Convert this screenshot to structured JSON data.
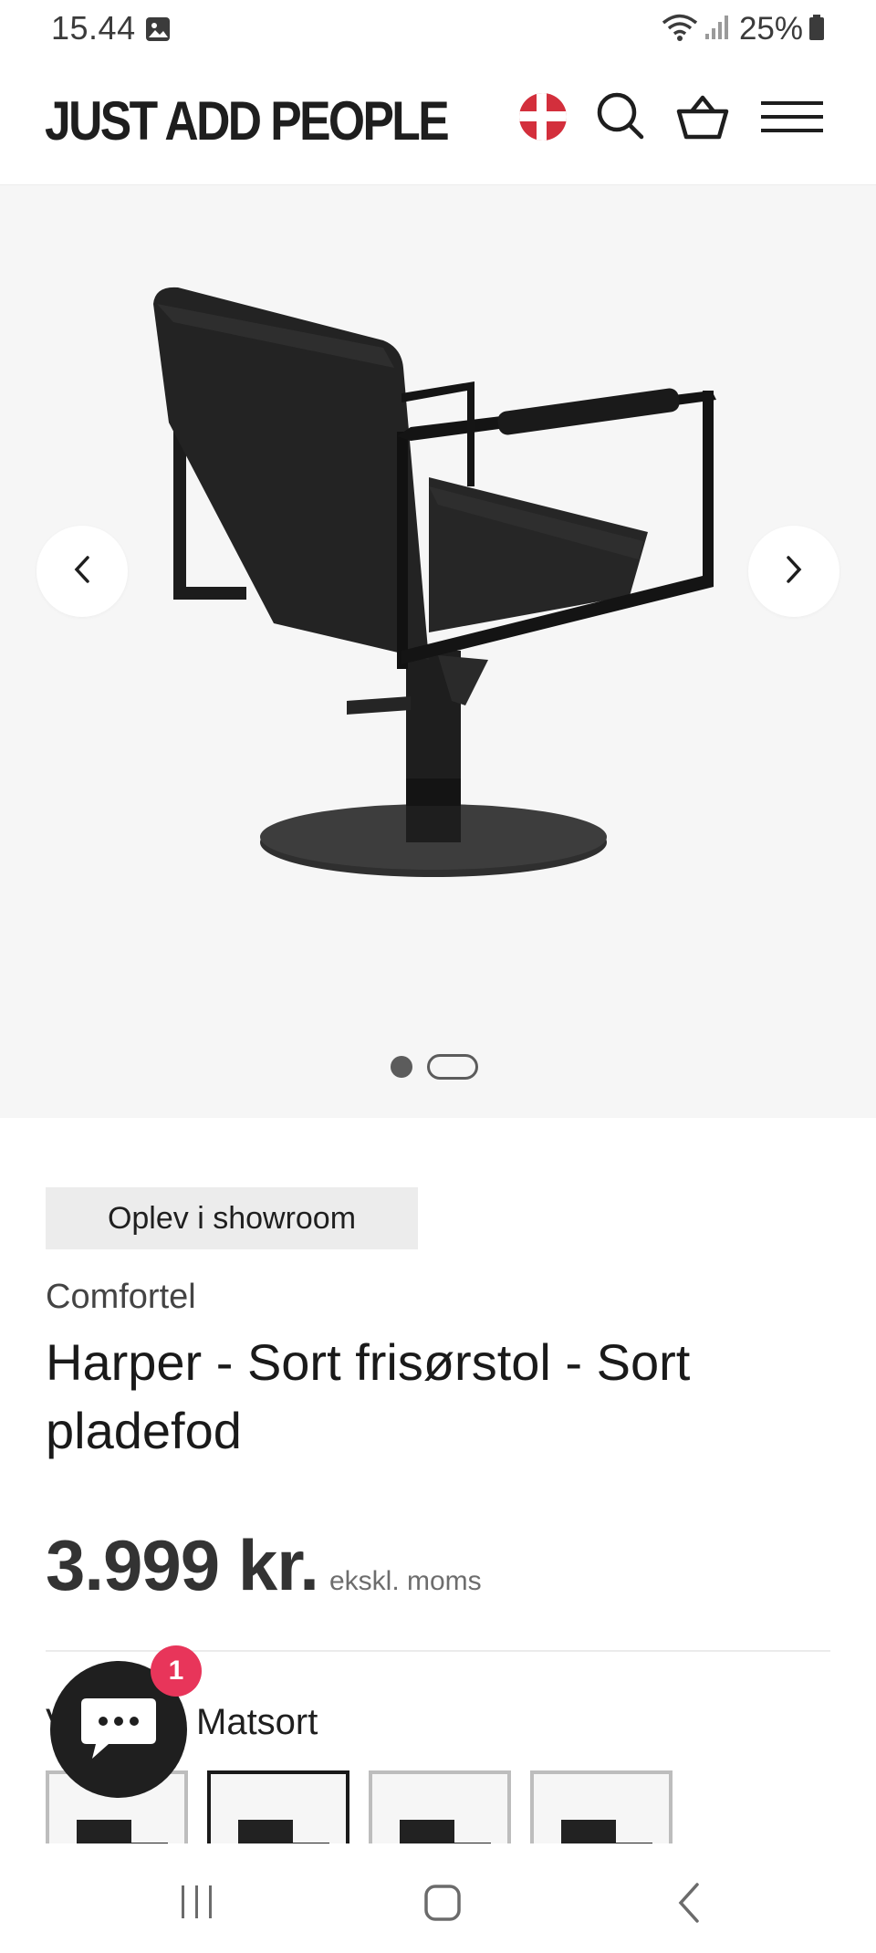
{
  "status_bar": {
    "time": "15.44",
    "battery": "25%",
    "icons": [
      "gallery-icon",
      "wifi-icon",
      "signal-icon",
      "battery-icon"
    ]
  },
  "header": {
    "logo": "JUST ADD PEOPLE",
    "icons": [
      "denmark-flag-icon",
      "search-icon",
      "basket-icon",
      "menu-icon"
    ]
  },
  "gallery": {
    "slide_count": 2,
    "active_slide": 1,
    "icons": [
      "chevron-left-icon",
      "chevron-right-icon"
    ]
  },
  "product": {
    "badge": "Oplev i showroom",
    "vendor": "Comfortel",
    "title": "Harper - Sort frisørstol - Sort pladefod",
    "price": "3.999 kr.",
    "vat_note": "ekskl. moms",
    "color_label_prefix": "V",
    "color_value": "Matsort",
    "swatch_count": 4,
    "selected_swatch": 2
  },
  "chat": {
    "unread_count": "1",
    "icon": "chat-bubble-icon"
  },
  "colors": {
    "accent_badge": "#e8355a",
    "flag_red": "#d32f3c",
    "gallery_bg": "#f6f6f6",
    "badge_bg": "#ececec"
  },
  "bottom_nav": {
    "icons": [
      "recent-apps-icon",
      "home-icon",
      "back-icon"
    ]
  }
}
